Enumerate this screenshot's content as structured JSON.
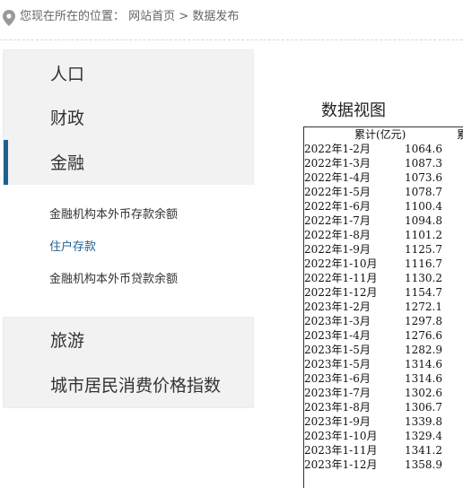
{
  "breadcrumb": {
    "prefix": "您现在所在的位置：",
    "home": "网站首页",
    "separator": ">",
    "current": "数据发布"
  },
  "sidebar": {
    "top_items": [
      {
        "label": "人口"
      },
      {
        "label": "财政"
      },
      {
        "label": "金融"
      }
    ],
    "sub_items": [
      {
        "label": "金融机构本外币存款余额"
      },
      {
        "label": "住户存款"
      },
      {
        "label": "金融机构本外币贷款余额"
      }
    ],
    "bottom_items": [
      {
        "label": "旅游"
      },
      {
        "label": "城市居民消费价格指数"
      }
    ]
  },
  "main": {
    "title": "数据视图",
    "table": {
      "headers": [
        "",
        "累计(亿元)",
        "累"
      ],
      "rows": [
        {
          "date": "2022年1-2月",
          "value": "1064.6"
        },
        {
          "date": "2022年1-3月",
          "value": "1087.3"
        },
        {
          "date": "2022年1-4月",
          "value": "1073.6"
        },
        {
          "date": "2022年1-5月",
          "value": "1078.7"
        },
        {
          "date": "2022年1-6月",
          "value": "1100.4"
        },
        {
          "date": "2022年1-7月",
          "value": "1094.8"
        },
        {
          "date": "2022年1-8月",
          "value": "1101.2"
        },
        {
          "date": "2022年1-9月",
          "value": "1125.7"
        },
        {
          "date": "2022年1-10月",
          "value": "1116.7"
        },
        {
          "date": "2022年1-11月",
          "value": "1130.2"
        },
        {
          "date": "2022年1-12月",
          "value": "1154.7"
        },
        {
          "date": "2023年1-2月",
          "value": "1272.1"
        },
        {
          "date": "2023年1-3月",
          "value": "1297.8"
        },
        {
          "date": "2023年1-4月",
          "value": "1276.6"
        },
        {
          "date": "2023年1-5月",
          "value": "1282.9"
        },
        {
          "date": "2023年1-5月",
          "value": "1314.6"
        },
        {
          "date": "2023年1-6月",
          "value": "1314.6"
        },
        {
          "date": "2023年1-7月",
          "value": "1302.6"
        },
        {
          "date": "2023年1-8月",
          "value": "1306.7"
        },
        {
          "date": "2023年1-9月",
          "value": "1339.8"
        },
        {
          "date": "2023年1-10月",
          "value": "1329.4"
        },
        {
          "date": "2023年1-11月",
          "value": "1341.2"
        },
        {
          "date": "2023年1-12月",
          "value": "1358.9"
        }
      ]
    }
  },
  "colors": {
    "accent": "#1f5f8f",
    "sidebar_bg": "#f2f2f2"
  }
}
